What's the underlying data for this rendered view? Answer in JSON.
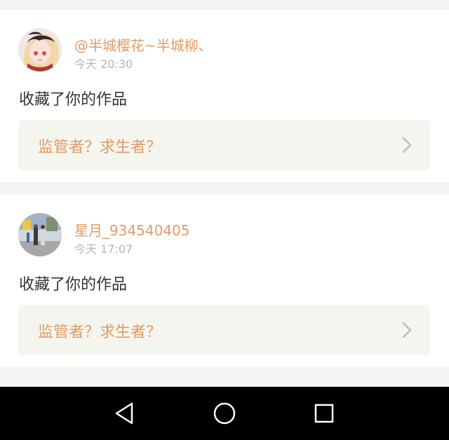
{
  "notifications": [
    {
      "username": "@半城樱花~半城柳、",
      "time": "今天 20:30",
      "action": "收藏了你的作品",
      "work_title": "监管者？求生者？",
      "avatar_icon": "avatar-anime-girl",
      "chevron_icon": "chevron-right-icon"
    },
    {
      "username": "星月_934540405",
      "time": "今天 17:07",
      "action": "收藏了你的作品",
      "work_title": "监管者？求生者？",
      "avatar_icon": "avatar-street-photo",
      "chevron_icon": "chevron-right-icon"
    }
  ],
  "navbar": {
    "back_icon": "triangle-back-icon",
    "home_icon": "circle-home-icon",
    "recent_icon": "square-recent-icon"
  },
  "colors": {
    "accent": "#e49a63",
    "time_gray": "#b5b5b5",
    "text_dark": "#333333",
    "link_bg": "#f5f5ef",
    "page_bg": "#f3f3f3"
  }
}
